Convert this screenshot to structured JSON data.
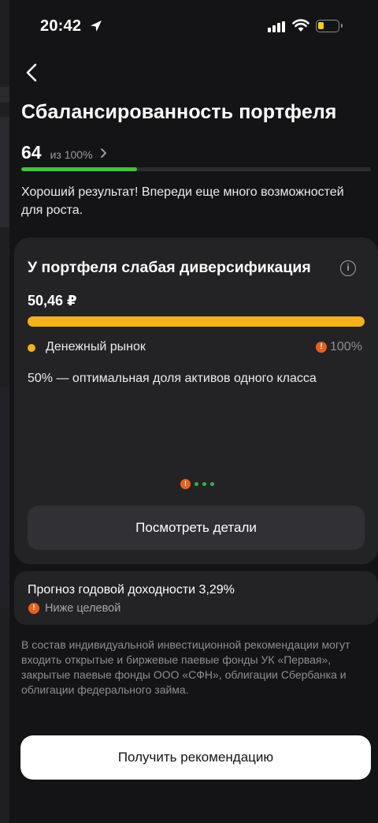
{
  "status_bar": {
    "time": "20:42"
  },
  "page": {
    "title": "Сбалансированность портфеля",
    "score": "64",
    "score_of": "из 100%",
    "score_progress_fraction": 0.33,
    "description": "Хороший результат! Впереди еще много возможностей для роста."
  },
  "card": {
    "title": "У портфеля слабая диверсификация",
    "amount": "50,46 ₽",
    "legend_label": "Денежный рынок",
    "legend_percent": "100%",
    "optimal_note": "50% — оптимальная доля активов одного класса",
    "details_button": "Посмотреть детали"
  },
  "forecast": {
    "title": "Прогноз годовой доходности 3,29%",
    "status": "Ниже целевой"
  },
  "disclaimer": "В состав индивидуальной инвестиционной рекомендации могут входить открытые и биржевые паевые фонды УК «Первая», закрытые паевые фонды ООО «СФН», облигации Сбербанка и облигации федерального займа.",
  "cta_button": "Получить рекомендацию",
  "colors": {
    "progress_green": "#46c03e",
    "asset_bar_orange": "#f4b11c",
    "warning_orange": "#e8601c"
  },
  "icons": [
    "back-chevron-icon",
    "location-arrow-icon",
    "signal-icon",
    "wifi-icon",
    "battery-icon",
    "info-icon",
    "warning-icon"
  ]
}
